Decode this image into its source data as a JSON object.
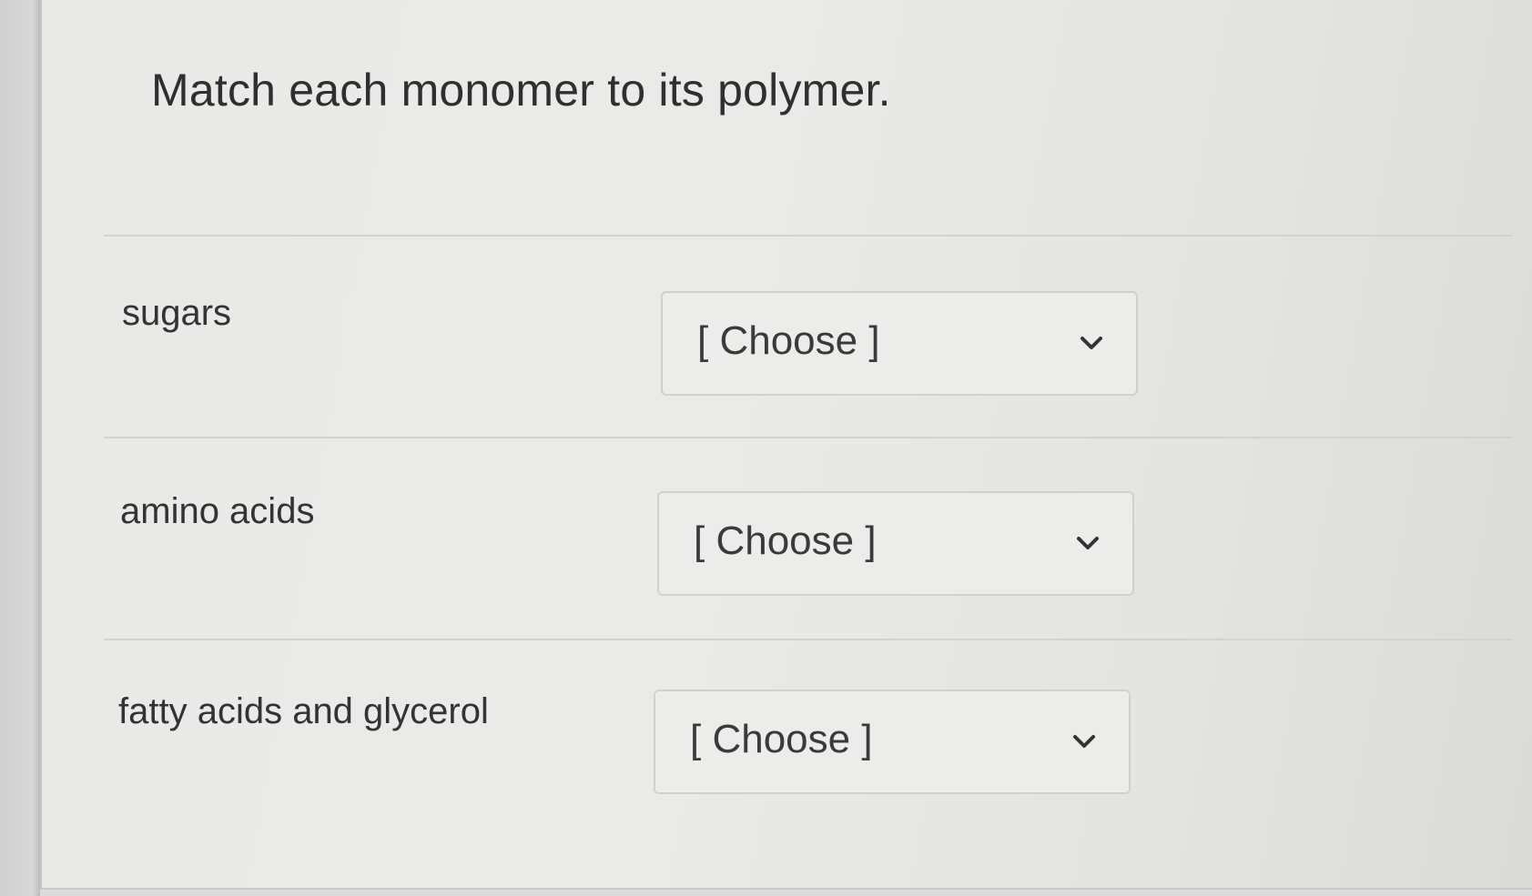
{
  "question": {
    "title": "Match each monomer to its polymer."
  },
  "rows": [
    {
      "monomer": "sugars",
      "selected": "[ Choose ]"
    },
    {
      "monomer": "amino acids",
      "selected": "[ Choose ]"
    },
    {
      "monomer": "fatty acids and glycerol",
      "selected": "[ Choose ]"
    }
  ],
  "icons": {
    "dropdown": "chevron-down-icon"
  }
}
